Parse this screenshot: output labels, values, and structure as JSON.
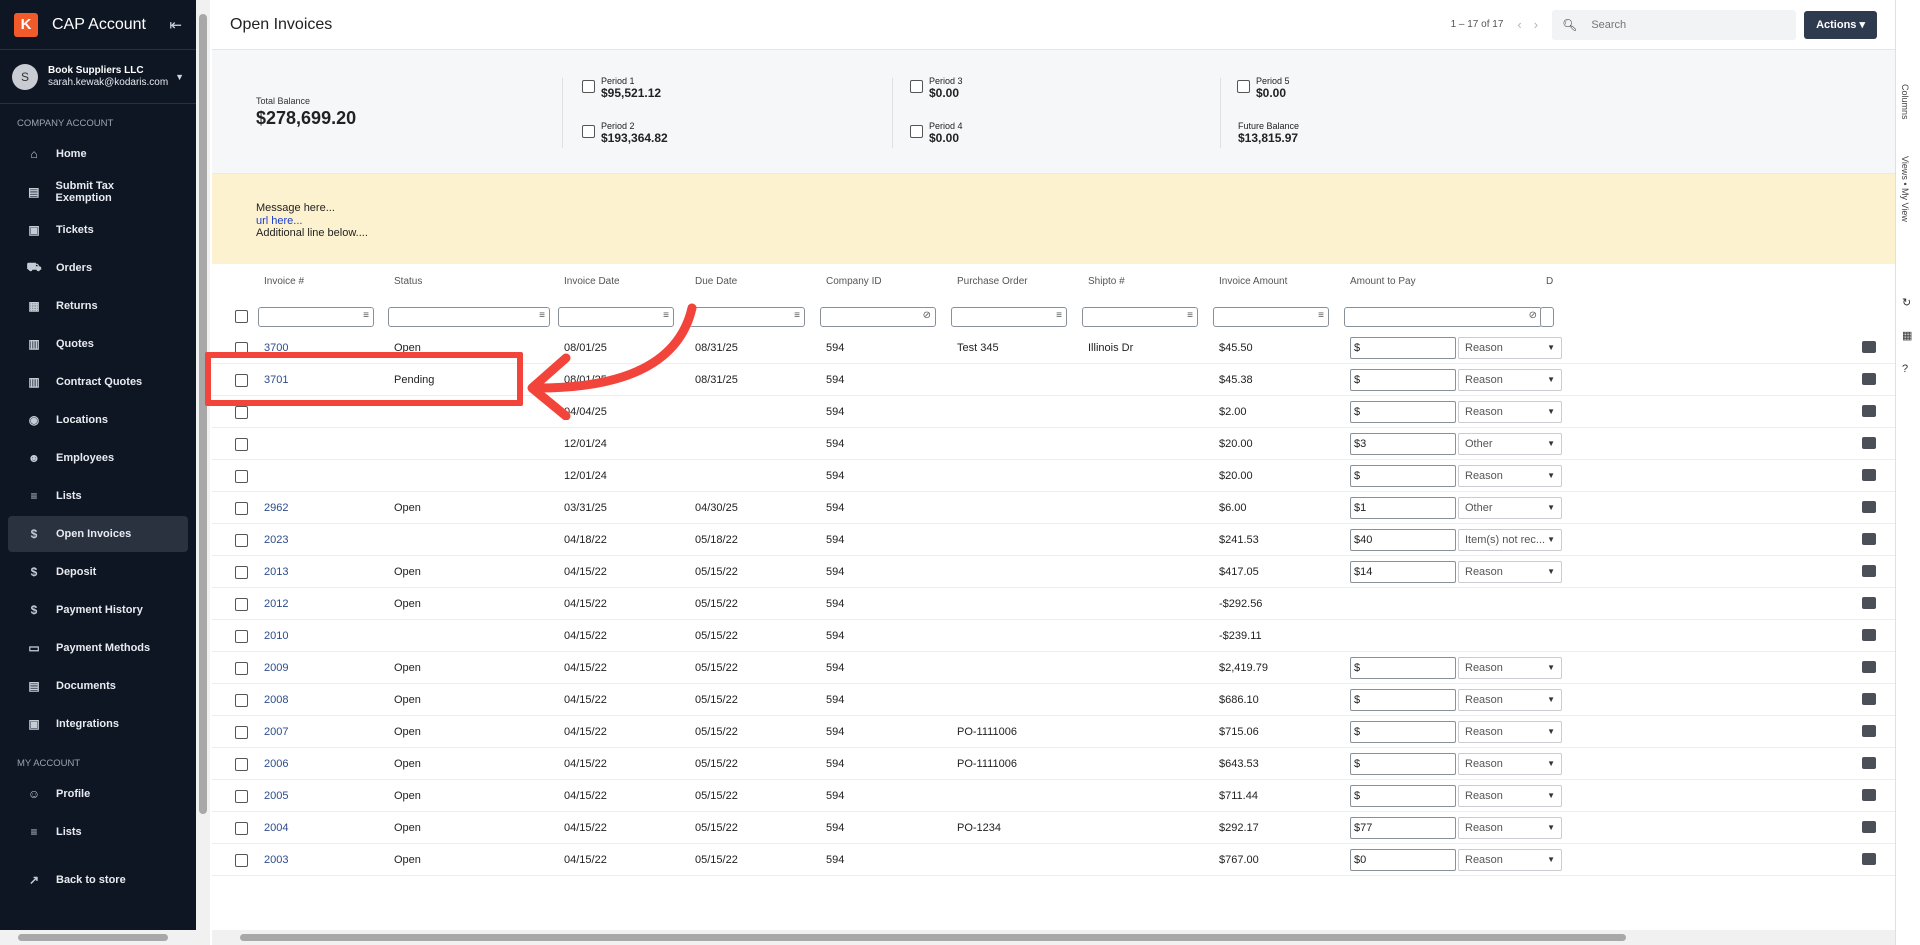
{
  "sidebar": {
    "app_title": "CAP Account",
    "user": {
      "initial": "S",
      "company": "Book Suppliers LLC",
      "email": "sarah.kewak@kodaris.com"
    },
    "section_company": "COMPANY ACCOUNT",
    "company_items": [
      {
        "label": "Home",
        "icon": "home-icon",
        "glyph": "⌂"
      },
      {
        "label": "Submit Tax Exemption",
        "icon": "document-icon",
        "glyph": "▤"
      },
      {
        "label": "Tickets",
        "icon": "ticket-icon",
        "glyph": "▣"
      },
      {
        "label": "Orders",
        "icon": "truck-icon",
        "glyph": "⛟"
      },
      {
        "label": "Returns",
        "icon": "returns-icon",
        "glyph": "▦"
      },
      {
        "label": "Quotes",
        "icon": "clipboard-icon",
        "glyph": "▥"
      },
      {
        "label": "Contract Quotes",
        "icon": "clipboard-icon",
        "glyph": "▥"
      },
      {
        "label": "Locations",
        "icon": "location-pin-icon",
        "glyph": "◉"
      },
      {
        "label": "Employees",
        "icon": "people-icon",
        "glyph": "☻"
      },
      {
        "label": "Lists",
        "icon": "list-icon",
        "glyph": "≡"
      },
      {
        "label": "Open Invoices",
        "icon": "dollar-icon",
        "glyph": "$"
      },
      {
        "label": "Deposit",
        "icon": "dollar-icon",
        "glyph": "$"
      },
      {
        "label": "Payment History",
        "icon": "dollar-icon",
        "glyph": "$"
      },
      {
        "label": "Payment Methods",
        "icon": "credit-card-icon",
        "glyph": "▭"
      },
      {
        "label": "Documents",
        "icon": "document-icon",
        "glyph": "▤"
      },
      {
        "label": "Integrations",
        "icon": "integrations-icon",
        "glyph": "▣"
      }
    ],
    "section_my": "MY ACCOUNT",
    "my_items": [
      {
        "label": "Profile",
        "icon": "person-icon",
        "glyph": "☺"
      },
      {
        "label": "Lists",
        "icon": "list-icon",
        "glyph": "≡"
      }
    ],
    "back_to_store": "Back to store"
  },
  "header": {
    "title": "Open Invoices",
    "pager": "1 – 17 of 17",
    "search_placeholder": "Search",
    "actions_label": "Actions ▾"
  },
  "summary": {
    "total_label": "Total Balance",
    "total_value": "$278,699.20",
    "periods": [
      {
        "label": "Period 1",
        "value": "$95,521.12"
      },
      {
        "label": "Period 2",
        "value": "$193,364.82"
      },
      {
        "label": "Period 3",
        "value": "$0.00"
      },
      {
        "label": "Period 4",
        "value": "$0.00"
      },
      {
        "label": "Period 5",
        "value": "$0.00"
      }
    ],
    "future_label": "Future Balance",
    "future_value": "$13,815.97"
  },
  "message": {
    "line1": "Message here...",
    "link": "url here...",
    "line3": "Additional line below...."
  },
  "table": {
    "columns": [
      "Invoice #",
      "Status",
      "Invoice Date",
      "Due Date",
      "Company ID",
      "Purchase Order",
      "Shipto #",
      "Invoice Amount",
      "Amount to Pay",
      "D"
    ],
    "rows": [
      {
        "invoice": "3700",
        "status": "Open",
        "inv_date": "08/01/25",
        "due": "08/31/25",
        "company": "594",
        "po": "Test 345",
        "shipto": "Illinois Dr",
        "amount": "$45.50",
        "pay": "",
        "reason": "Reason",
        "payable": true
      },
      {
        "invoice": "3701",
        "status": "Pending",
        "inv_date": "08/01/25",
        "due": "08/31/25",
        "company": "594",
        "po": "",
        "shipto": "",
        "amount": "$45.38",
        "pay": "",
        "reason": "Reason",
        "payable": true
      },
      {
        "invoice": "",
        "status": "",
        "inv_date": "04/04/25",
        "due": "",
        "company": "594",
        "po": "",
        "shipto": "",
        "amount": "$2.00",
        "pay": "",
        "reason": "Reason",
        "payable": true
      },
      {
        "invoice": "",
        "status": "",
        "inv_date": "12/01/24",
        "due": "",
        "company": "594",
        "po": "",
        "shipto": "",
        "amount": "$20.00",
        "pay": "3",
        "reason": "Other",
        "payable": true
      },
      {
        "invoice": "",
        "status": "",
        "inv_date": "12/01/24",
        "due": "",
        "company": "594",
        "po": "",
        "shipto": "",
        "amount": "$20.00",
        "pay": "",
        "reason": "Reason",
        "payable": true
      },
      {
        "invoice": "2962",
        "status": "Open",
        "inv_date": "03/31/25",
        "due": "04/30/25",
        "company": "594",
        "po": "",
        "shipto": "",
        "amount": "$6.00",
        "pay": "1",
        "reason": "Other",
        "payable": true
      },
      {
        "invoice": "2023",
        "status": "",
        "inv_date": "04/18/22",
        "due": "05/18/22",
        "company": "594",
        "po": "",
        "shipto": "",
        "amount": "$241.53",
        "pay": "40",
        "reason": "Item(s) not rec...",
        "payable": true
      },
      {
        "invoice": "2013",
        "status": "Open",
        "inv_date": "04/15/22",
        "due": "05/15/22",
        "company": "594",
        "po": "",
        "shipto": "",
        "amount": "$417.05",
        "pay": "14",
        "reason": "Reason",
        "payable": true
      },
      {
        "invoice": "2012",
        "status": "Open",
        "inv_date": "04/15/22",
        "due": "05/15/22",
        "company": "594",
        "po": "",
        "shipto": "",
        "amount": "-$292.56",
        "pay": "",
        "reason": "",
        "payable": false
      },
      {
        "invoice": "2010",
        "status": "",
        "inv_date": "04/15/22",
        "due": "05/15/22",
        "company": "594",
        "po": "",
        "shipto": "",
        "amount": "-$239.11",
        "pay": "",
        "reason": "",
        "payable": false
      },
      {
        "invoice": "2009",
        "status": "Open",
        "inv_date": "04/15/22",
        "due": "05/15/22",
        "company": "594",
        "po": "",
        "shipto": "",
        "amount": "$2,419.79",
        "pay": "",
        "reason": "Reason",
        "payable": true
      },
      {
        "invoice": "2008",
        "status": "Open",
        "inv_date": "04/15/22",
        "due": "05/15/22",
        "company": "594",
        "po": "",
        "shipto": "",
        "amount": "$686.10",
        "pay": "",
        "reason": "Reason",
        "payable": true
      },
      {
        "invoice": "2007",
        "status": "Open",
        "inv_date": "04/15/22",
        "due": "05/15/22",
        "company": "594",
        "po": "PO-1111006",
        "shipto": "",
        "amount": "$715.06",
        "pay": "",
        "reason": "Reason",
        "payable": true
      },
      {
        "invoice": "2006",
        "status": "Open",
        "inv_date": "04/15/22",
        "due": "05/15/22",
        "company": "594",
        "po": "PO-1111006",
        "shipto": "",
        "amount": "$643.53",
        "pay": "",
        "reason": "Reason",
        "payable": true
      },
      {
        "invoice": "2005",
        "status": "Open",
        "inv_date": "04/15/22",
        "due": "05/15/22",
        "company": "594",
        "po": "",
        "shipto": "",
        "amount": "$711.44",
        "pay": "",
        "reason": "Reason",
        "payable": true
      },
      {
        "invoice": "2004",
        "status": "Open",
        "inv_date": "04/15/22",
        "due": "05/15/22",
        "company": "594",
        "po": "PO-1234",
        "shipto": "",
        "amount": "$292.17",
        "pay": "77",
        "reason": "Reason",
        "payable": true
      },
      {
        "invoice": "2003",
        "status": "Open",
        "inv_date": "04/15/22",
        "due": "05/15/22",
        "company": "594",
        "po": "",
        "shipto": "",
        "amount": "$767.00",
        "pay": "0",
        "reason": "Reason",
        "payable": true
      }
    ]
  },
  "right_rail": {
    "columns_label": "Columns",
    "views_label": "Views • My View"
  },
  "colors": {
    "sidebar_bg": "#0f1623",
    "accent": "#2e3a4e",
    "annotation": "#f2443a",
    "message_bg": "#fdf2d0"
  }
}
